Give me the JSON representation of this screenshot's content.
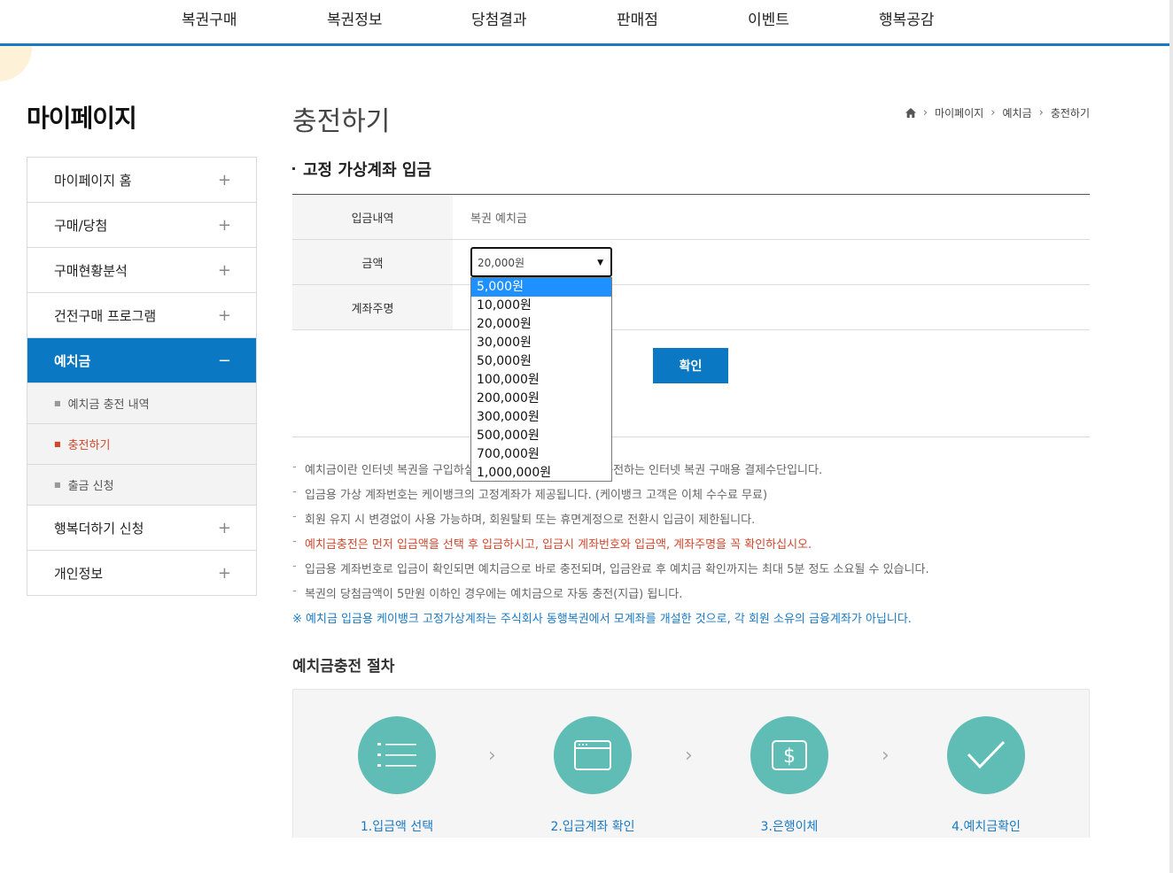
{
  "nav": [
    "복권구매",
    "복권정보",
    "당첨결과",
    "판매점",
    "이벤트",
    "행복공감"
  ],
  "sidebar": {
    "title": "마이페이지",
    "items": [
      {
        "label": "마이페이지 홈",
        "icon": "plus-icon"
      },
      {
        "label": "구매/당첨",
        "icon": "plus-icon"
      },
      {
        "label": "구매현황분석",
        "icon": "plus-icon"
      },
      {
        "label": "건전구매 프로그램",
        "icon": "plus-icon"
      },
      {
        "label": "예치금",
        "icon": "minus-icon"
      },
      {
        "label": "행복더하기 신청",
        "icon": "plus-icon"
      },
      {
        "label": "개인정보",
        "icon": "plus-icon"
      }
    ],
    "sub_items": [
      "예치금 충전 내역",
      "충전하기",
      "출금 신청"
    ],
    "plus_glyph": "+",
    "minus_glyph": "−"
  },
  "page": {
    "title": "충전하기",
    "breadcrumb": [
      "마이페이지",
      "예치금",
      "충전하기"
    ],
    "section_title": "고정 가상계좌 입금"
  },
  "form": {
    "rows": [
      {
        "label": "입금내역",
        "value": "복권 예치금"
      },
      {
        "label": "금액",
        "value": ""
      },
      {
        "label": "계좌주명",
        "value": ""
      }
    ],
    "amount_selected": "20,000원",
    "amount_options": [
      "5,000원",
      "10,000원",
      "20,000원",
      "30,000원",
      "50,000원",
      "100,000원",
      "200,000원",
      "300,000원",
      "500,000원",
      "700,000원",
      "1,000,000원"
    ],
    "highlighted_option": "5,000원",
    "confirm_label": "확인"
  },
  "notes": [
    {
      "text": "예치금이란 인터넷 복권을 구입하실 때 사용할 수 있도록 미리 충전하는 인터넷 복권 구매용 결제수단입니다.",
      "style": "normal"
    },
    {
      "text": "입금용 가상 계좌번호는 케이뱅크의 고정계좌가 제공됩니다. (케이뱅크 고객은 이체 수수료 무료)",
      "style": "normal"
    },
    {
      "text": "회원 유지 시 변경없이 사용 가능하며, 회원탈퇴 또는 휴면계정으로 전환시 입금이 제한됩니다.",
      "style": "normal"
    },
    {
      "text": "예치금충전은 먼저 입금액을 선택 후 입금하시고, 입금시 계좌번호와 입금액, 계좌주명을 꼭 확인하십시오.",
      "style": "red"
    },
    {
      "text": "입금용 계좌번호로 입금이 확인되면 예치금으로 바로 충전되며, 입금완료 후 예치금 확인까지는 최대 5분 정도 소요될 수 있습니다.",
      "style": "normal"
    },
    {
      "text": "복권의 당첨금액이 5만원 이하인 경우에는 예치금으로 자동 충전(지급) 됩니다.",
      "style": "normal"
    }
  ],
  "notice": "※ 예치금 입금용 케이뱅크 고정가상계좌는 주식회사 동행복권에서 모계좌를 개설한 것으로, 각 회원 소유의 금융계좌가 아닙니다.",
  "note_dash": "-",
  "process": {
    "title": "예치금충전 절차",
    "steps": [
      {
        "label": "1.입금액 선택",
        "icon": "list-icon"
      },
      {
        "label": "2.입금계좌 확인",
        "icon": "browser-window-icon"
      },
      {
        "label": "3.은행이체",
        "icon": "dollar-icon"
      },
      {
        "label": "4.예치금확인",
        "icon": "checkmark-icon"
      }
    ],
    "accent": "#5fbdb5"
  },
  "colors": {
    "primary": "#0a78c2",
    "warning": "#d2462c",
    "highlight": "#1e90ff"
  }
}
